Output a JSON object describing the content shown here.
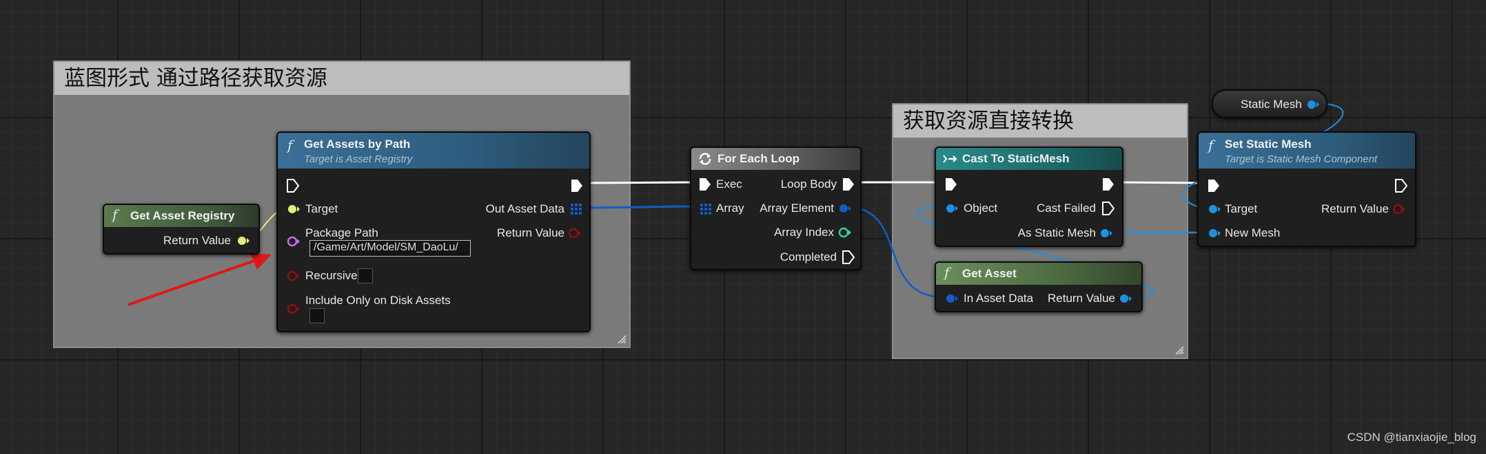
{
  "comments": {
    "left_title": "蓝图形式 通过路径获取资源",
    "right_title": "获取资源直接转换"
  },
  "nodes": {
    "get_asset_registry": {
      "title": "Get Asset Registry",
      "return_value": "Return Value"
    },
    "get_assets_by_path": {
      "title": "Get Assets by Path",
      "subtitle": "Target is Asset Registry",
      "target": "Target",
      "package_path": "Package Path",
      "package_path_value": "/Game/Art/Model/SM_DaoLu/",
      "recursive": "Recursive",
      "include_only_on_disk": "Include Only on Disk Assets",
      "out_asset_data": "Out Asset Data",
      "return_value": "Return Value"
    },
    "for_each_loop": {
      "title": "For Each Loop",
      "exec": "Exec",
      "array": "Array",
      "loop_body": "Loop Body",
      "array_element": "Array Element",
      "array_index": "Array Index",
      "completed": "Completed"
    },
    "cast_to_static_mesh": {
      "title": "Cast To StaticMesh",
      "object": "Object",
      "cast_failed": "Cast Failed",
      "as_static_mesh": "As Static Mesh"
    },
    "get_asset": {
      "title": "Get Asset",
      "in_asset_data": "In Asset Data",
      "return_value": "Return Value"
    },
    "static_mesh_var": {
      "label": "Static Mesh"
    },
    "set_static_mesh": {
      "title": "Set Static Mesh",
      "subtitle": "Target is Static Mesh Component",
      "target": "Target",
      "new_mesh": "New Mesh",
      "return_value": "Return Value"
    }
  },
  "watermark": "CSDN @tianxiaojie_blog",
  "colors": {
    "exec": "#ffffff",
    "object_pin": "#1f8fe0",
    "struct_pin": "#0e5dc7",
    "int_pin": "#2fd3a6",
    "bool_pin": "#8b0f0f",
    "string_pin": "#c86ce8",
    "registry_pin": "#e3ef7a",
    "func_header_green": "#5a7a4e",
    "func_header_blue": "#2d5d7e",
    "macro_header": "#6e6e6e",
    "cast_header": "#1f6b6b",
    "arrow": "#e01818"
  }
}
